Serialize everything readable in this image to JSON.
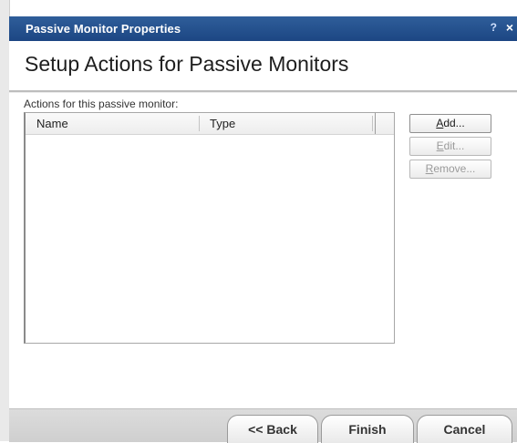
{
  "window": {
    "title": "Passive Monitor Properties",
    "help_glyph": "?",
    "close_glyph": "×"
  },
  "page": {
    "heading": "Setup Actions for Passive Monitors"
  },
  "actions": {
    "label": "Actions for this passive monitor:",
    "columns": [
      "Name",
      "Type"
    ],
    "rows": []
  },
  "side_buttons": {
    "add": {
      "mnemonic": "A",
      "rest": "dd...",
      "enabled": true
    },
    "edit": {
      "mnemonic": "E",
      "rest": "dit...",
      "enabled": false
    },
    "remove": {
      "mnemonic": "R",
      "rest": "emove...",
      "enabled": false
    }
  },
  "footer": {
    "back_label": "<< Back",
    "finish_label": "Finish",
    "cancel_label": "Cancel"
  },
  "colors": {
    "titlebar": "#1c4683",
    "disabled_text": "#9a9a9a"
  }
}
